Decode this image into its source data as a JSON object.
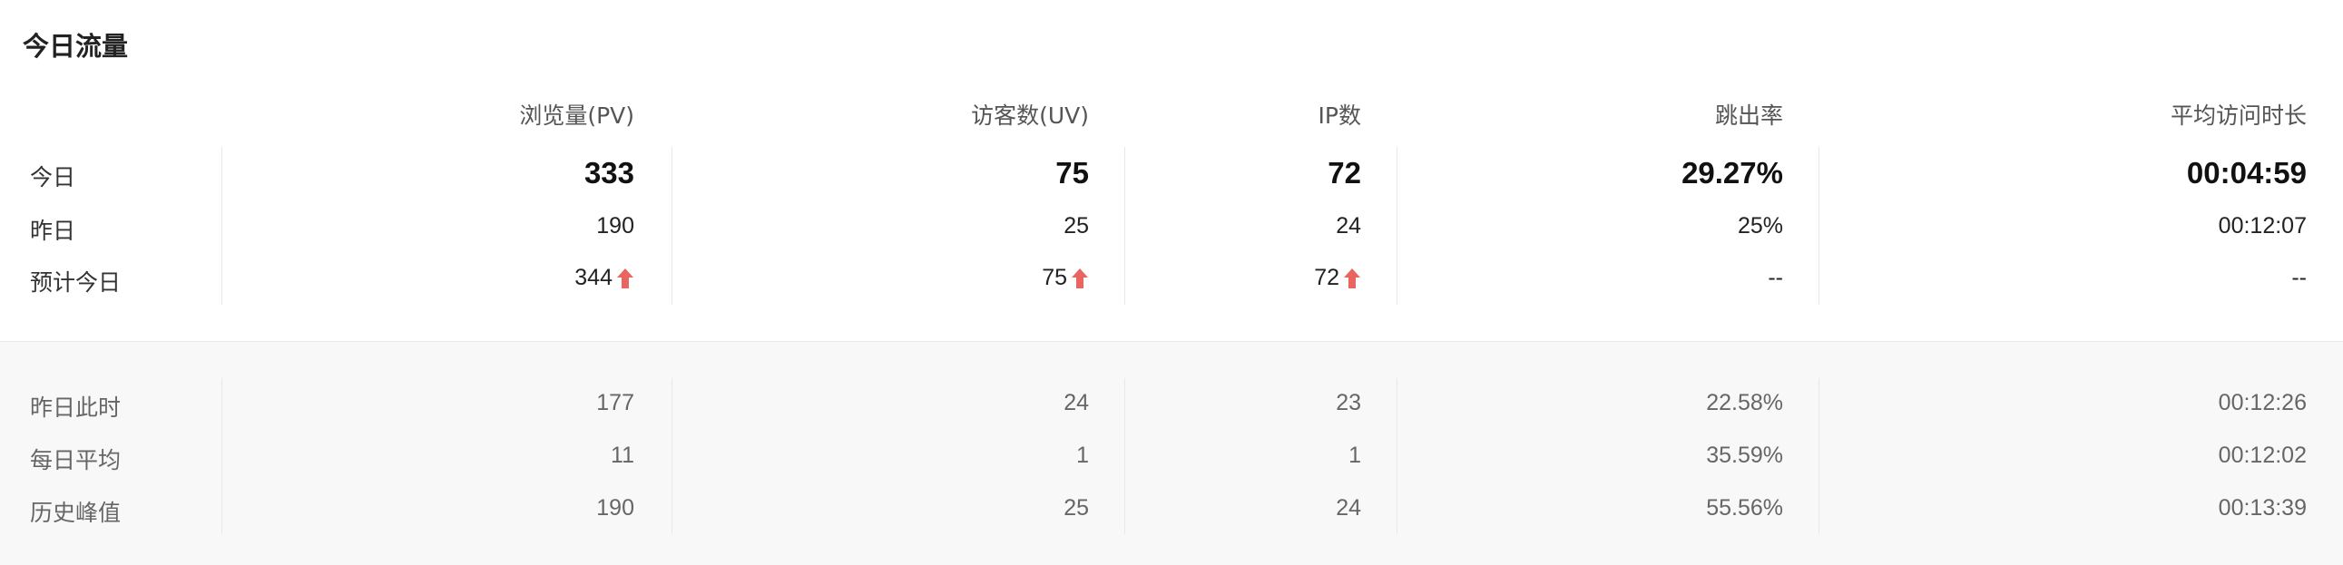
{
  "title": "今日流量",
  "columns": [
    "浏览量(PV)",
    "访客数(UV)",
    "IP数",
    "跳出率",
    "平均访问时长"
  ],
  "today_rows": [
    {
      "label": "今日",
      "values": [
        "333",
        "75",
        "72",
        "29.27%",
        "00:04:59"
      ],
      "trend": [
        false,
        false,
        false,
        false,
        false
      ]
    },
    {
      "label": "昨日",
      "values": [
        "190",
        "25",
        "24",
        "25%",
        "00:12:07"
      ],
      "trend": [
        false,
        false,
        false,
        false,
        false
      ]
    },
    {
      "label": "预计今日",
      "values": [
        "344",
        "75",
        "72",
        "--",
        "--"
      ],
      "trend": [
        true,
        true,
        true,
        false,
        false
      ]
    }
  ],
  "history_rows": [
    {
      "label": "昨日此时",
      "values": [
        "177",
        "24",
        "23",
        "22.58%",
        "00:12:26"
      ]
    },
    {
      "label": "每日平均",
      "values": [
        "11",
        "1",
        "1",
        "35.59%",
        "00:12:02"
      ]
    },
    {
      "label": "历史峰值",
      "values": [
        "190",
        "25",
        "24",
        "55.56%",
        "00:13:39"
      ]
    }
  ],
  "colors": {
    "trend_up": "#e8665f"
  },
  "icons": {
    "trend_up": "arrow-up-icon"
  }
}
